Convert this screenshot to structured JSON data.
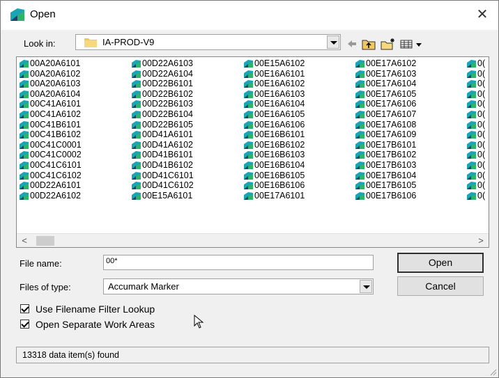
{
  "window": {
    "title": "Open",
    "close_glyph": "✕"
  },
  "look_in": {
    "label": "Look in:",
    "value": "IA-PROD-V9"
  },
  "toolbar": {
    "icons": [
      "back-arrow-icon",
      "up-folder-icon",
      "new-folder-icon",
      "view-menu-icon"
    ]
  },
  "file_list": {
    "columns": [
      [
        "00A20A6101",
        "00A20A6102",
        "00A20A6103",
        "00A20A6104",
        "00C41A6101",
        "00C41A6102",
        "00C41B6101",
        "00C41B6102",
        "00C41C0001",
        "00C41C0002",
        "00C41C6101",
        "00C41C6102",
        "00D22A6101",
        "00D22A6102"
      ],
      [
        "00D22A6103",
        "00D22A6104",
        "00D22B6101",
        "00D22B6102",
        "00D22B6103",
        "00D22B6104",
        "00D22B6105",
        "00D41A6101",
        "00D41A6102",
        "00D41B6101",
        "00D41B6102",
        "00D41C6101",
        "00D41C6102",
        "00E15A6101"
      ],
      [
        "00E15A6102",
        "00E16A6101",
        "00E16A6102",
        "00E16A6103",
        "00E16A6104",
        "00E16A6105",
        "00E16A6106",
        "00E16B6101",
        "00E16B6102",
        "00E16B6103",
        "00E16B6104",
        "00E16B6105",
        "00E16B6106",
        "00E17A6101"
      ],
      [
        "00E17A6102",
        "00E17A6103",
        "00E17A6104",
        "00E17A6105",
        "00E17A6106",
        "00E17A6107",
        "00E17A6108",
        "00E17A6109",
        "00E17B6101",
        "00E17B6102",
        "00E17B6103",
        "00E17B6104",
        "00E17B6105",
        "00E17B6106"
      ],
      [
        "0(",
        "0(",
        "0(",
        "0(",
        "0(",
        "0(",
        "0(",
        "0(",
        "0(",
        "0(",
        "0(",
        "0(",
        "0(",
        "0("
      ]
    ]
  },
  "file_name": {
    "label": "File name:",
    "value": "00*"
  },
  "files_of_type": {
    "label": "Files of type:",
    "value": "Accumark Marker"
  },
  "buttons": {
    "open": "Open",
    "cancel": "Cancel"
  },
  "options": {
    "use_filter": {
      "label": "Use Filename Filter Lookup",
      "checked": true
    },
    "separate_work_areas": {
      "label": "Open Separate Work Areas",
      "checked": true
    }
  },
  "status": "13318 data item(s) found",
  "colors": {
    "accent": "#1e8fd8",
    "icon_teal": "#1aa5b4",
    "icon_dark": "#17456b"
  }
}
